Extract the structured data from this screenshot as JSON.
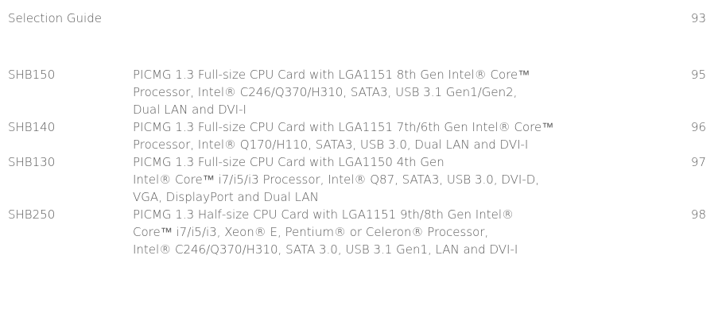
{
  "header": {
    "title": "Selection Guide",
    "page": "93"
  },
  "entries": [
    {
      "model": "SHB150",
      "lines": [
        "PICMG 1.3 Full-size CPU Card with LGA1151 8th Gen Intel® Core™",
        "Processor, Intel® C246/Q370/H310, SATA3, USB 3.1 Gen1/Gen2,",
        "Dual LAN and DVI-I"
      ],
      "page": "95"
    },
    {
      "model": "SHB140",
      "lines": [
        "PICMG 1.3 Full-size CPU Card with LGA1151 7th/6th Gen Intel® Core™",
        "Processor, Intel® Q170/H110, SATA3, USB 3.0, Dual LAN and DVI-I"
      ],
      "page": "96"
    },
    {
      "model": "SHB130",
      "lines": [
        "PICMG 1.3 Full-size CPU Card with LGA1150 4th Gen",
        "Intel® Core™ i7/i5/i3 Processor, Intel® Q87, SATA3, USB 3.0, DVI-D,",
        "VGA, DisplayPort and Dual LAN"
      ],
      "page": "97"
    },
    {
      "model": "SHB250",
      "lines": [
        "PICMG 1.3 Half-size CPU Card with LGA1151 9th/8th Gen Intel®",
        "Core™ i7/i5/i3, Xeon® E, Pentium® or Celeron® Processor,",
        "Intel® C246/Q370/H310, SATA 3.0, USB 3.1 Gen1, LAN and DVI-I"
      ],
      "page": "98"
    }
  ]
}
